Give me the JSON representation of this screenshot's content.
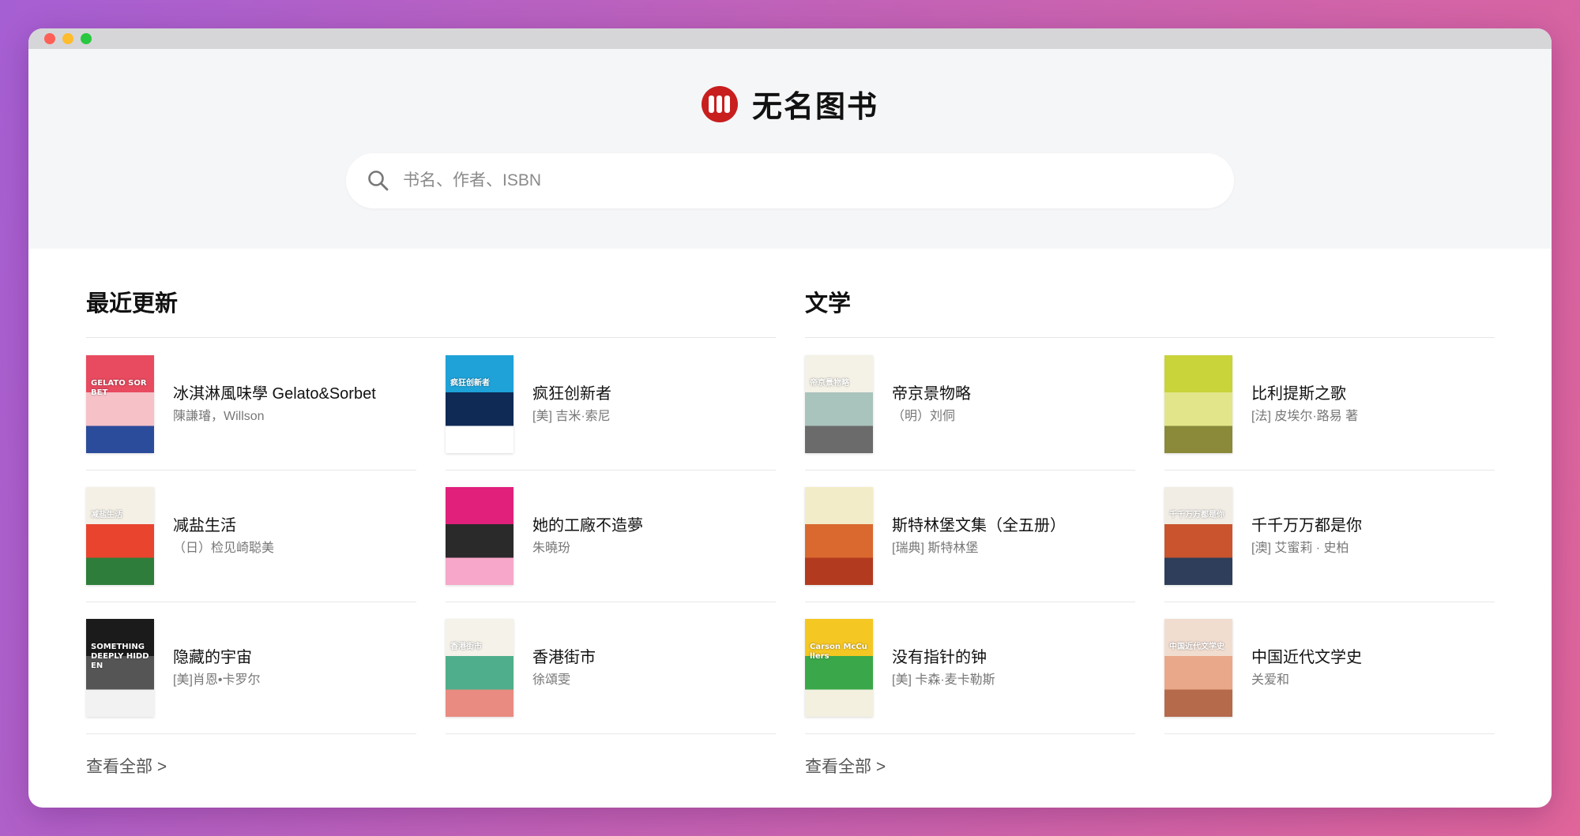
{
  "window": {
    "controls": [
      "close",
      "minimize",
      "maximize"
    ]
  },
  "brand": {
    "name": "无名图书",
    "logo_icon": "library-logo-icon",
    "logo_color": "#c81e1e"
  },
  "search": {
    "placeholder": "书名、作者、ISBN",
    "value": "",
    "icon": "search-icon"
  },
  "sections": [
    {
      "title": "最近更新",
      "view_all": "查看全部 >",
      "books": [
        {
          "title": "冰淇淋風味學 Gelato&Sorbet",
          "author": "陳謙璿，Willson",
          "cover_text": "GELATO SORBET",
          "cover_colors": [
            "#e84a5f",
            "#f6c1c7",
            "#2b4c9b"
          ]
        },
        {
          "title": "疯狂创新者",
          "author": "[美] 吉米·索尼",
          "cover_text": "疯狂创新者",
          "cover_colors": [
            "#1ea2d8",
            "#0f2a55",
            "#ffffff"
          ]
        },
        {
          "title": "减盐生活",
          "author": "（日）检见崎聪美",
          "cover_text": "减盐生活",
          "cover_colors": [
            "#f4f0e6",
            "#e8442e",
            "#2e7d3b"
          ]
        },
        {
          "title": "她的工廠不造夢",
          "author": "朱曉玢",
          "cover_text": "",
          "cover_colors": [
            "#e0207a",
            "#2a2a2a",
            "#f7a7c9"
          ]
        },
        {
          "title": "隐藏的宇宙",
          "author": "[美]肖恩•卡罗尔",
          "cover_text": "SOMETHING DEEPLY HIDDEN",
          "cover_colors": [
            "#1b1b1b",
            "#555555",
            "#f2f2f2"
          ]
        },
        {
          "title": "香港街市",
          "author": "徐頌雯",
          "cover_text": "香港街市",
          "cover_colors": [
            "#f5f2ea",
            "#4fae8b",
            "#e98b80"
          ]
        }
      ]
    },
    {
      "title": "文学",
      "view_all": "查看全部 >",
      "books": [
        {
          "title": "帝京景物略",
          "author": "（明）刘侗",
          "cover_text": "帝京景物略",
          "cover_colors": [
            "#f4f1e6",
            "#a9c3bd",
            "#6b6b6b"
          ]
        },
        {
          "title": "比利提斯之歌",
          "author": "[法] 皮埃尔·路易 著",
          "cover_text": "",
          "cover_colors": [
            "#c9d33a",
            "#e3e58a",
            "#8a8a3a"
          ]
        },
        {
          "title": "斯特林堡文集（全五册）",
          "author": "[瑞典] 斯特林堡",
          "cover_text": "",
          "cover_colors": [
            "#f3ecc8",
            "#d9692f",
            "#b23a1f"
          ]
        },
        {
          "title": "千千万万都是你",
          "author": "[澳] 艾蜜莉 · 史柏",
          "cover_text": "千千万万都是你",
          "cover_colors": [
            "#f1ede5",
            "#c9542e",
            "#2f3e5a"
          ]
        },
        {
          "title": "没有指针的钟",
          "author": "[美] 卡森·麦卡勒斯",
          "cover_text": "Carson McCullers",
          "cover_colors": [
            "#f5c722",
            "#3aa84a",
            "#f3f0e0"
          ]
        },
        {
          "title": "中国近代文学史",
          "author": "关爱和",
          "cover_text": "中国近代文学史",
          "cover_colors": [
            "#f1ddd0",
            "#e9a889",
            "#b56a4c"
          ]
        }
      ]
    }
  ]
}
